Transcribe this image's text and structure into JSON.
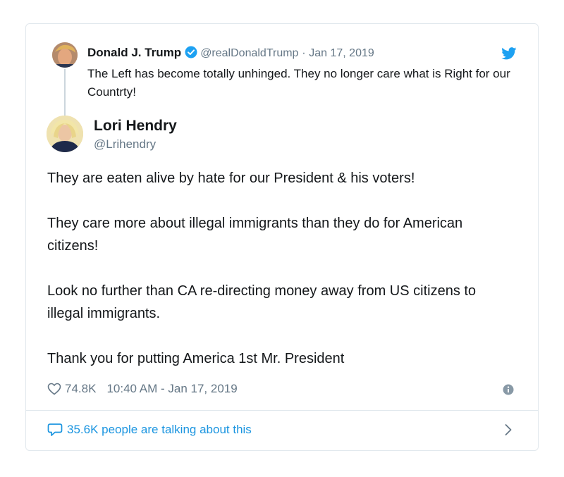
{
  "quoted": {
    "name": "Donald J. Trump",
    "handle": "@realDonaldTrump",
    "separator": "·",
    "date": "Jan 17, 2019",
    "text": "The Left has become totally unhinged. They no longer care what is Right for our Countrty!"
  },
  "author": {
    "name": "Lori Hendry",
    "handle": "@Lrihendry"
  },
  "body": [
    "They are eaten alive by hate for our President & his voters!",
    "They care more about illegal immigrants than they do for American citizens!",
    "Look no further than CA re-directing money away from US citizens to illegal immigrants.",
    "Thank you for putting America 1st Mr. President"
  ],
  "footer": {
    "likes": "74.8K",
    "timestamp": "10:40 AM - Jan 17, 2019"
  },
  "conversation": {
    "label": "35.6K people are talking about this"
  },
  "icons": {
    "verified": "verified-badge-icon",
    "bird": "twitter-bird-icon",
    "heart": "heart-icon",
    "info": "info-icon",
    "reply": "speech-bubble-icon",
    "chevron": "chevron-right-icon"
  },
  "colors": {
    "accent": "#1da1f2",
    "link": "#1b95e0",
    "muted": "#657786",
    "border": "#e1e8ed"
  }
}
